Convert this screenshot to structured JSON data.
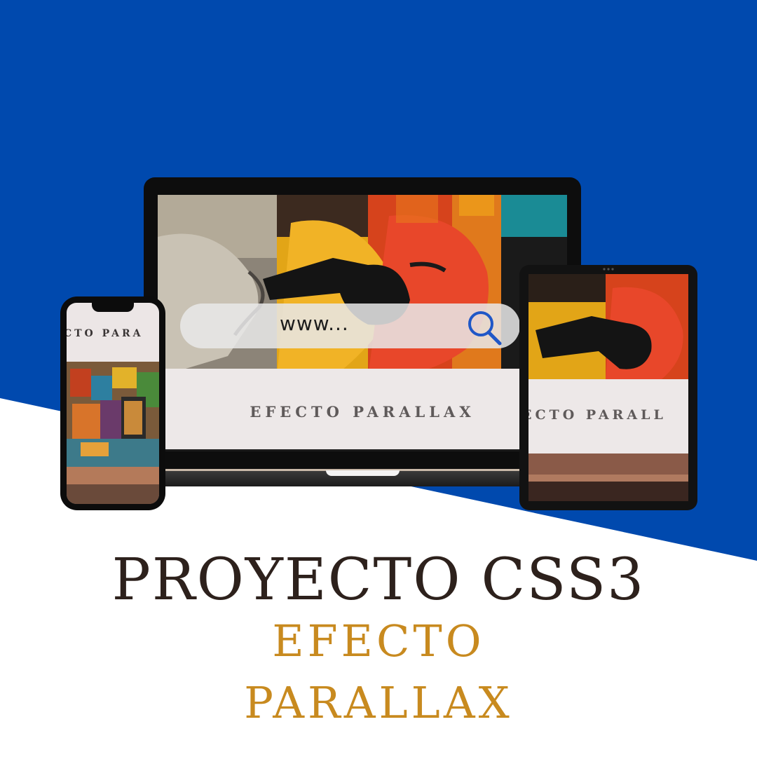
{
  "colors": {
    "background_blue": "#0049ae",
    "background_white": "#ffffff",
    "title_color": "#2d211c",
    "subtitle_color": "#c88a1f"
  },
  "laptop": {
    "search_text": "www...",
    "band_text": "EFECTO PARALLAX"
  },
  "phone": {
    "title_text": "CTO PARA"
  },
  "tablet": {
    "band_text": "ECTO PARALL"
  },
  "heading": {
    "title": "PROYECTO CSS3",
    "subtitle_line1": "EFECTO",
    "subtitle_line2": "PARALLAX"
  },
  "icons": {
    "search": "search-icon"
  }
}
